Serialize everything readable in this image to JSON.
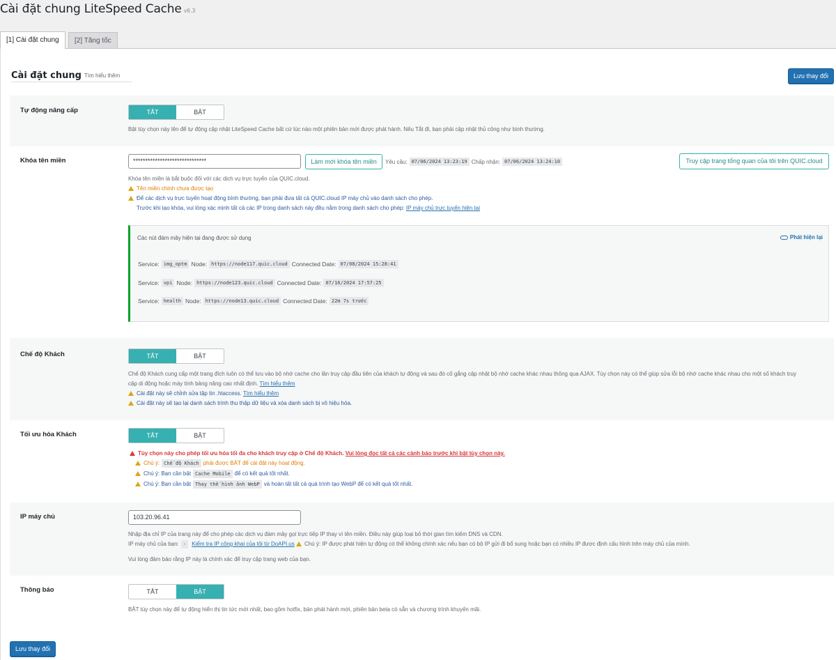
{
  "page": {
    "title": "Cài đặt chung LiteSpeed Cache",
    "version": "v6.3"
  },
  "tabs": [
    {
      "label": "[1] Cài đặt chung"
    },
    {
      "label": "[2] Tăng tốc"
    }
  ],
  "section": {
    "title": "Cài đặt chung",
    "learn_more": "Tìm hiểu thêm",
    "save_label": "Lưu thay đổi"
  },
  "toggle_labels": {
    "off": "TẮT",
    "on": "BẬT"
  },
  "auto_upgrade": {
    "label": "Tự động nâng cấp",
    "state": "off",
    "desc": "Bật tùy chọn này lên để tự động cập nhật LiteSpeed Cache bất cứ lúc nào một phiên bản mới được phát hành. Nếu Tắt đi, bạn phải cập nhật thủ công như bình thường."
  },
  "domain_key": {
    "label": "Khóa tên miền",
    "value": "******************************",
    "refresh_button": "Làm mới khóa tên miền",
    "requested_label": "Yêu cầu:",
    "requested_value": "07/06/2024 13:23:19",
    "approved_label": "Chấp nhận:",
    "approved_value": "07/06/2024 13:24:10",
    "dashboard_button": "Truy cập trang tổng quan của tôi trên QUIC.cloud",
    "desc": "Khóa tên miền là bắt buộc đối với các dịch vụ trực tuyến của QUIC.cloud.",
    "warn_main_domain": "Tên miền chính chưa được tạo",
    "warn_whitelist": "Để các dịch vụ trực tuyến hoạt động bình thường, bạn phải đưa tất cả QUIC.cloud IP máy chủ vào danh sách cho phép.",
    "note_before": "Trước khi tạo khóa, vui lòng xác minh tất cả các IP trong danh sách này đều nằm trong danh sách cho phép:",
    "note_link": "IP máy chủ trực tuyến hiện tại",
    "nodes": {
      "title": "Các nút đám mây hiện tại đang được sử dụng",
      "redetect": "Phát hiện lại",
      "service_label": "Service:",
      "node_label": "Node:",
      "date_label": "Connected Date:",
      "items": [
        {
          "service": "img_optm",
          "node": "https://node117.quic.cloud",
          "date": "07/08/2024 15:28:41"
        },
        {
          "service": "vpi",
          "node": "https://node123.quic.cloud",
          "date": "07/16/2024 17:57:25"
        },
        {
          "service": "health",
          "node": "https://node13.quic.cloud",
          "date": "22m 7s trước"
        }
      ]
    }
  },
  "guest_mode": {
    "label": "Chế độ Khách",
    "state": "off",
    "desc": "Chế độ Khách cung cấp một trang đích luôn có thể lưu vào bộ nhớ cache cho lần truy cập đầu tiên của khách tự động và sau đó cố gắng cập nhật bộ nhớ cache khác nhau thông qua AJAX. Tùy chọn này có thể giúp sửa lỗi bộ nhớ cache khác nhau cho một số khách truy",
    "desc2": "cập di động hoặc máy tính bảng nâng cao nhất định.",
    "learn_more": "Tìm hiểu thêm",
    "warn_htaccess": "Cài đặt này sẽ chỉnh sửa tập tin .htaccess.",
    "warn_htaccess_link": "Tìm hiểu thêm",
    "warn_regenerate": "Cài đặt này sẽ tạo lại danh sách trình thu thập dữ liệu và xóa danh sách bị vô hiệu hóa."
  },
  "guest_optm": {
    "label": "Tối ưu hóa Khách",
    "state": "off",
    "warn_main": "Tùy chọn này cho phép tối ưu hóa tối đa cho khách truy cập ở Chế độ Khách.",
    "warn_main_link": "Vui lòng đọc tất cả các cảnh báo trước khi bật tùy chọn này.",
    "note1_prefix": "Chú ý:",
    "note1_code": "Chế độ Khách",
    "note1_suffix": "phải được BẬT để cài đặt này hoạt động.",
    "note2_prefix": "Chú ý: Bạn cần bật",
    "note2_code": "Cache Mobile",
    "note2_suffix": "để có kết quả tốt nhất.",
    "note3_prefix": "Chú ý: Bạn cần bật",
    "note3_code": "Thay thế hình ảnh WebP",
    "note3_suffix": "và hoàn tất tất cả quá trình tạo WebP để có kết quả tốt nhất."
  },
  "server_ip": {
    "label": "IP máy chủ",
    "value": "103.20.96.41",
    "desc": "Nhập địa chỉ IP của trang này để cho phép các dịch vụ đám mây gọi trực tiếp IP thay vì tên miền. Điều này giúp loại bỏ thời gian tìm kiếm DNS và CDN.",
    "your_ip_label": "IP máy chủ của bạn:",
    "your_ip_value": "-",
    "check_link": "Kiểm tra IP công khai của tôi từ DoAPI.us",
    "note": "Chú ý: IP được phát hiện tự động có thể không chính xác nếu bạn có bộ IP gửi đi bổ sung hoặc bạn có nhiều IP được định cấu hình trên máy chủ của mình.",
    "confirm": "Vui lòng đảm bảo rằng IP này là chính xác để truy cập trang web của bạn."
  },
  "notifications": {
    "label": "Thông báo",
    "state": "on",
    "desc": "BẬT tùy chọn này để tự động hiển thị tin tức mới nhất, bao gồm hotfix, bản phát hành mới, phiên bản beta có sẵn và chương trình khuyến mãi."
  }
}
